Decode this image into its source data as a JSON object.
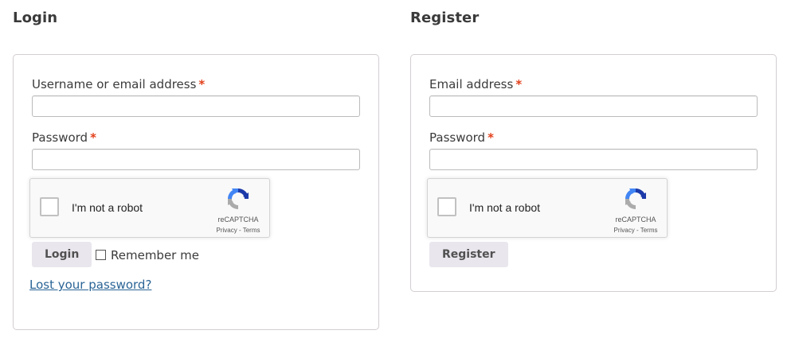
{
  "login": {
    "heading": "Login",
    "username_label": "Username or email address",
    "required_mark": "*",
    "username_value": "",
    "password_label": "Password",
    "password_value": "",
    "recaptcha": {
      "label": "I'm not a robot",
      "brand": "reCAPTCHA",
      "privacy": "Privacy",
      "separator": " - ",
      "terms": "Terms",
      "icon": "recaptcha-logo-icon"
    },
    "submit_label": "Login",
    "remember_label": "Remember me",
    "lost_password_label": "Lost your password?"
  },
  "register": {
    "heading": "Register",
    "email_label": "Email address",
    "required_mark": "*",
    "email_value": "",
    "password_label": "Password",
    "password_value": "",
    "recaptcha": {
      "label": "I'm not a robot",
      "brand": "reCAPTCHA",
      "privacy": "Privacy",
      "separator": " - ",
      "terms": "Terms",
      "icon": "recaptcha-logo-icon"
    },
    "submit_label": "Register"
  },
  "colors": {
    "required": "#e2401c",
    "link": "#2a6496",
    "button_bg": "#e9e6ed",
    "border": "#d3ced2"
  }
}
